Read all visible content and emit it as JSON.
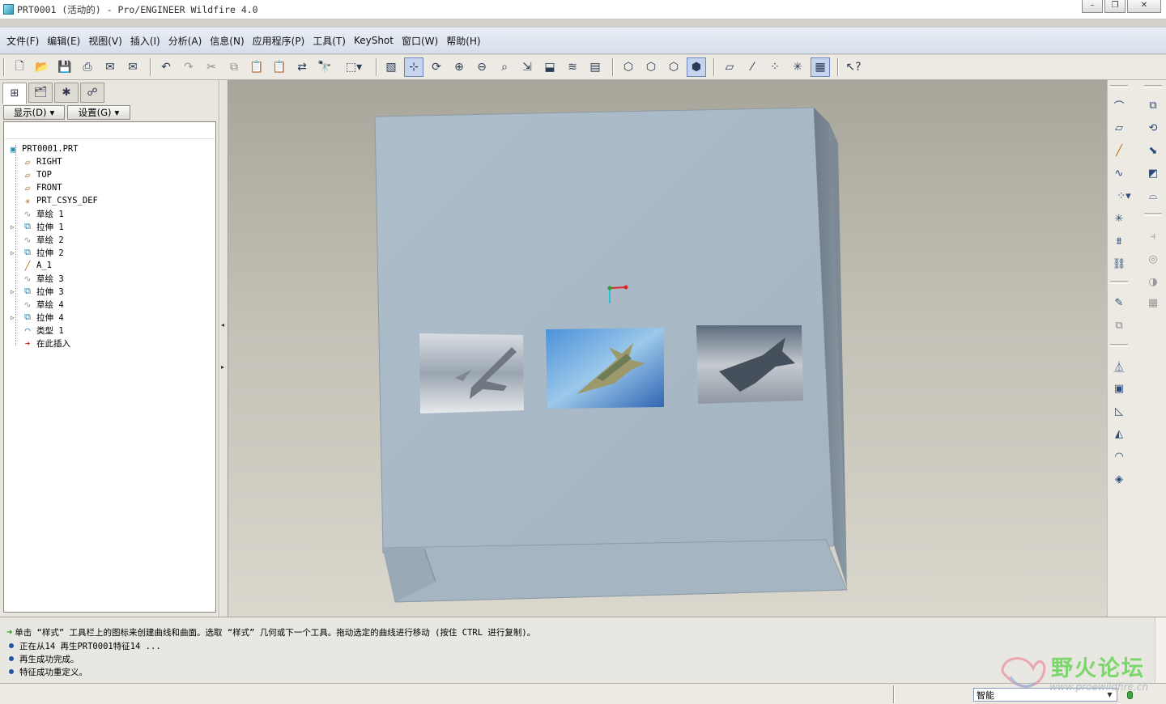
{
  "window": {
    "title": "PRT0001 (活动的) - Pro/ENGINEER Wildfire 4.0",
    "buttons": {
      "minimize": "–",
      "restore": "❐",
      "close": "✕"
    }
  },
  "menu": [
    "文件(F)",
    "编辑(E)",
    "视图(V)",
    "插入(I)",
    "分析(A)",
    "信息(N)",
    "应用程序(P)",
    "工具(T)",
    "KeyShot",
    "窗口(W)",
    "帮助(H)"
  ],
  "toolbar_icons": [
    "new-file-icon",
    "open-file-icon",
    "save-icon",
    "print-icon",
    "send-mail-icon",
    "send-mail-attachment-icon",
    "undo-icon",
    "redo-icon",
    "cut-icon",
    "copy-icon",
    "paste-icon",
    "paste-special-icon",
    "regenerate-icon",
    "find-icon",
    "select-box-icon",
    "repaint-icon",
    "spin-center-icon",
    "orient-mode-icon",
    "zoom-in-icon",
    "zoom-out-icon",
    "refit-icon",
    "reorient-icon",
    "saved-views-icon",
    "layers-icon",
    "view-manager-icon",
    "wireframe-icon",
    "hidden-line-icon",
    "no-hidden-icon",
    "shading-icon",
    "datum-planes-icon",
    "datum-axes-icon",
    "datum-points-icon",
    "csys-icon",
    "annotations-icon",
    "context-help-icon"
  ],
  "model_tree": {
    "tabs": [
      "model-tree-tab",
      "folder-browser-tab",
      "favorites-tab",
      "connections-tab"
    ],
    "show_label": "显示(D)",
    "settings_label": "设置(G)",
    "items": [
      {
        "label": "PRT0001.PRT",
        "icon": "part-icon",
        "level": 0
      },
      {
        "label": "RIGHT",
        "icon": "datum-plane-icon",
        "level": 1
      },
      {
        "label": "TOP",
        "icon": "datum-plane-icon",
        "level": 1
      },
      {
        "label": "FRONT",
        "icon": "datum-plane-icon",
        "level": 1
      },
      {
        "label": "PRT_CSYS_DEF",
        "icon": "csys-icon",
        "level": 1
      },
      {
        "label": "草绘 1",
        "icon": "sketch-icon",
        "level": 1
      },
      {
        "label": "拉伸 1",
        "icon": "extrude-icon",
        "level": 1,
        "expandable": true
      },
      {
        "label": "草绘 2",
        "icon": "sketch-icon",
        "level": 1
      },
      {
        "label": "拉伸 2",
        "icon": "extrude-icon",
        "level": 1,
        "expandable": true
      },
      {
        "label": "A_1",
        "icon": "datum-axis-icon",
        "level": 1
      },
      {
        "label": "草绘 3",
        "icon": "sketch-icon",
        "level": 1
      },
      {
        "label": "拉伸 3",
        "icon": "extrude-icon",
        "level": 1,
        "expandable": true
      },
      {
        "label": "草绘 4",
        "icon": "sketch-icon",
        "level": 1
      },
      {
        "label": "拉伸 4",
        "icon": "extrude-icon",
        "level": 1,
        "expandable": true
      },
      {
        "label": "类型 1",
        "icon": "style-feature-icon",
        "level": 1
      },
      {
        "label": "在此插入",
        "icon": "insert-here-icon",
        "level": 1
      }
    ]
  },
  "right_toolbar_icons": [
    "style-curve-icon",
    "datum-plane-tool-icon",
    "datum-axis-tool-icon",
    "datum-curve-icon",
    "datum-point-tool-icon",
    "csys-tool-icon",
    "analysis-icon",
    "chain-icon",
    "sketch-tool-icon",
    "sketch-reorient-icon",
    "extrude-tool-icon",
    "revolve-tool-icon",
    "variable-sweep-icon",
    "boundary-blend-icon",
    "style-tool-icon",
    "hole-icon",
    "shell-icon",
    "rib-icon",
    "draft-icon",
    "round-icon",
    "chamfer-icon",
    "trim-icon",
    "mirror-icon",
    "merge-icon",
    "intersect-icon",
    "pattern-icon"
  ],
  "messages": [
    {
      "type": "prompt",
      "text": "单击 “样式” 工具栏上的图标来创建曲线和曲面。选取 “样式” 几何或下一个工具。拖动选定的曲线进行移动 (按住 CTRL 进行复制)。"
    },
    {
      "type": "info",
      "text": "正在从14 再生PRT0001特征14 ..."
    },
    {
      "type": "info",
      "text": "再生成功完成。"
    },
    {
      "type": "info",
      "text": "特征成功重定义。"
    }
  ],
  "status": {
    "filter_value": "智能"
  },
  "watermark": {
    "text": "野火论坛",
    "url": "www.proewildfire.cn"
  },
  "colors": {
    "model_face": "#a9b9c7",
    "background_top": "#a8a69a",
    "background_bottom": "#dad8cd",
    "csys_x": "#e0262c",
    "csys_y": "#2aa52a",
    "csys_z": "#26c2d8"
  }
}
